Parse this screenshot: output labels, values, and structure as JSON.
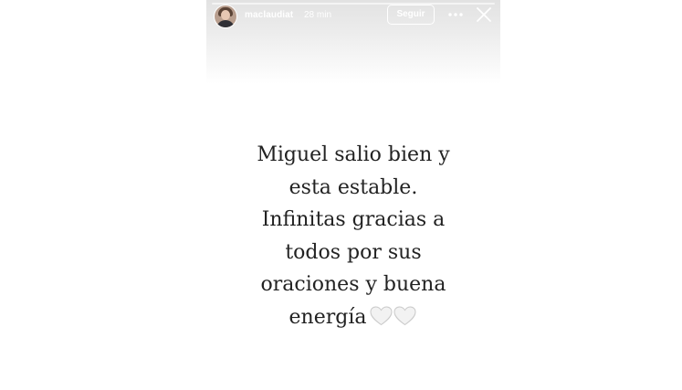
{
  "story": {
    "username": "maclaudiat",
    "time_ago": "28 min",
    "follow_label": "Seguir",
    "text_lines": [
      "Miguel salio bien y",
      "esta estable.",
      "Infinitas gracias a",
      "todos por sus",
      "oraciones y buena",
      "energía"
    ],
    "emoji_icons": [
      "white-heart-icon",
      "white-heart-icon"
    ]
  },
  "colors": {
    "text": "#222222",
    "header_text": "#ffffff",
    "heart_fill": "#f2f2f2",
    "heart_stroke": "#c9c9c9"
  }
}
